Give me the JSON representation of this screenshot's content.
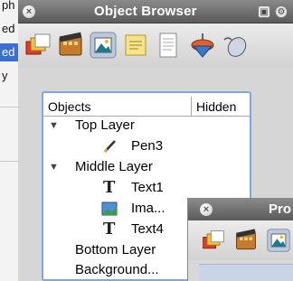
{
  "background_app": {
    "lines": [
      "ph paper",
      "ed",
      "ed",
      "y",
      "",
      ""
    ]
  },
  "object_browser": {
    "title": "Object Browser",
    "close_glyph": "×",
    "toolbar_icons": [
      "layers-icon",
      "film-icon",
      "image-icon",
      "note-icon",
      "document-icon",
      "spinning-top-icon",
      "mouse-icon"
    ],
    "table": {
      "columns": [
        "Objects",
        "Hidden"
      ],
      "rows": [
        {
          "label": "Top Layer",
          "expanded": true,
          "indent": 0,
          "icon": ""
        },
        {
          "label": "Pen3",
          "indent": 1,
          "icon": "pen-icon"
        },
        {
          "label": "Middle Layer",
          "expanded": true,
          "indent": 0,
          "icon": ""
        },
        {
          "label": "Text1",
          "indent": 1,
          "icon": "text-icon",
          "glyph": "T"
        },
        {
          "label": "Ima...",
          "indent": 1,
          "icon": "image-thumbnail-icon"
        },
        {
          "label": "Text4",
          "indent": 1,
          "icon": "text-icon",
          "glyph": "T"
        },
        {
          "label": "Bottom Layer",
          "indent": 0,
          "icon": ""
        },
        {
          "label": "Background...",
          "indent": 0,
          "icon": ""
        }
      ]
    }
  },
  "properties_window": {
    "title": "Pro",
    "close_glyph": "×"
  }
}
